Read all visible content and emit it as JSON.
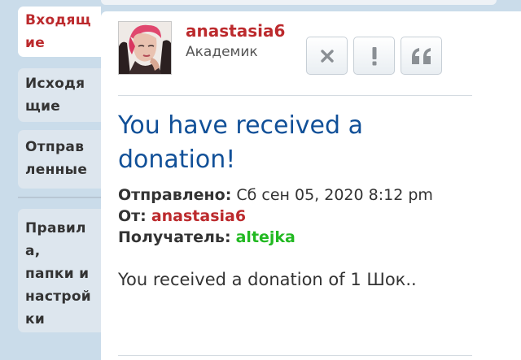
{
  "sidebar": {
    "tabs": [
      {
        "lines": [
          "Входящ",
          "ие"
        ],
        "active": true
      },
      {
        "lines": [
          "Исходя",
          "щие"
        ],
        "active": false
      },
      {
        "lines": [
          "Отправ",
          "ленные"
        ],
        "active": false
      },
      {
        "lines": [
          "Правил",
          "а,",
          "папки и",
          "настрой",
          "ки"
        ],
        "active": false
      }
    ]
  },
  "message": {
    "author": {
      "name": "anastasia6",
      "rank": "Академик",
      "avatar_icon": "user-avatar-photo"
    },
    "actions": [
      {
        "name": "delete-button",
        "icon": "close-icon"
      },
      {
        "name": "report-button",
        "icon": "exclamation-icon"
      },
      {
        "name": "quote-button",
        "icon": "quote-icon"
      }
    ],
    "subject": "You have received a donation!",
    "sent_label": "Отправлено:",
    "sent_value": "Сб сен 05, 2020 8:12 pm",
    "from_label": "От:",
    "from_value": "anastasia6",
    "to_label": "Получатель:",
    "to_value": "altejka",
    "body": "You received a donation of 1 Шок.."
  },
  "colors": {
    "accent_red": "#bc2a2d",
    "link_blue": "#115098",
    "recipient_green": "#22b922",
    "page_bg": "#cadcea"
  }
}
